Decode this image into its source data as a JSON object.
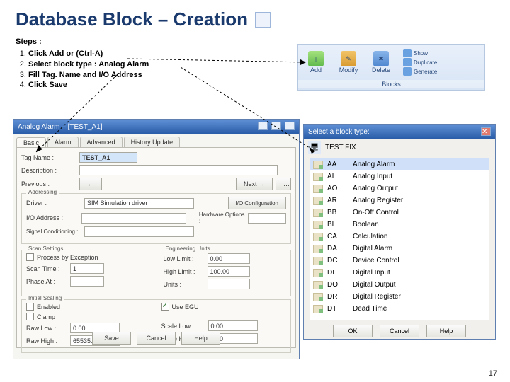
{
  "title": "Database Block – Creation",
  "steps_heading": "Steps :",
  "steps": [
    "Click Add or (Ctrl-A)",
    "Select block type : Analog Alarm",
    "Fill Tag. Name and I/O Address",
    "Click Save"
  ],
  "ribbon": {
    "add": "Add",
    "modify": "Modify",
    "delete": "Delete",
    "show": "Show",
    "duplicate": "Duplicate",
    "generate": "Generate",
    "caption": "Blocks"
  },
  "analog_dialog": {
    "title": "Analog Alarm – [TEST_A1]",
    "tabs": [
      "Basic",
      "Alarm",
      "Advanced",
      "History Update"
    ],
    "tag_label": "Tag Name :",
    "tag_value": "TEST_A1",
    "desc_label": "Description :",
    "prev_label": "Previous :",
    "prev_btn": "←",
    "next_btn": "Next →",
    "addr_group": "Addressing",
    "driver_label": "Driver :",
    "driver_value": "SIM   Simulation driver",
    "io_label": "I/O Address :",
    "hwopt_label": "Hardware Options :",
    "sigcond_label": "Signal Conditioning :",
    "scan_group": "Scan Settings",
    "proc_label": "Process by Exception",
    "scantime_label": "Scan Time :",
    "scantime_value": "1",
    "phase_label": "Phase At :",
    "eng_group": "Engineering Units",
    "lowlimit_label": "Low Limit :",
    "lowlimit_value": "0.00",
    "highlimit_label": "High Limit :",
    "highlimit_value": "100.00",
    "units_label": "Units :",
    "initscale_group": "Initial Scaling",
    "enabled_label": "Enabled",
    "clamp_label": "Clamp",
    "rawlow_label": "Raw Low :",
    "rawlow_value": "0.00",
    "rawhigh_label": "Raw High :",
    "rawhigh_value": "65535.00",
    "useegu_label": "Use EGU",
    "scalelow_label": "Scale Low :",
    "scalelow_value": "0.00",
    "scalehigh_label": "Scale High :",
    "scalehigh_value": "0.00",
    "save": "Save",
    "cancel": "Cancel",
    "help": "Help"
  },
  "select_dialog": {
    "title": "Select a block type:",
    "root": "TEST FIX",
    "items": [
      {
        "code": "AA",
        "name": "Analog Alarm"
      },
      {
        "code": "AI",
        "name": "Analog Input"
      },
      {
        "code": "AO",
        "name": "Analog Output"
      },
      {
        "code": "AR",
        "name": "Analog Register"
      },
      {
        "code": "BB",
        "name": "On-Off Control"
      },
      {
        "code": "BL",
        "name": "Boolean"
      },
      {
        "code": "CA",
        "name": "Calculation"
      },
      {
        "code": "DA",
        "name": "Digital Alarm"
      },
      {
        "code": "DC",
        "name": "Device Control"
      },
      {
        "code": "DI",
        "name": "Digital Input"
      },
      {
        "code": "DO",
        "name": "Digital Output"
      },
      {
        "code": "DR",
        "name": "Digital Register"
      },
      {
        "code": "DT",
        "name": "Dead Time"
      }
    ],
    "ok": "OK",
    "cancel": "Cancel",
    "help": "Help"
  },
  "page_number": "17"
}
